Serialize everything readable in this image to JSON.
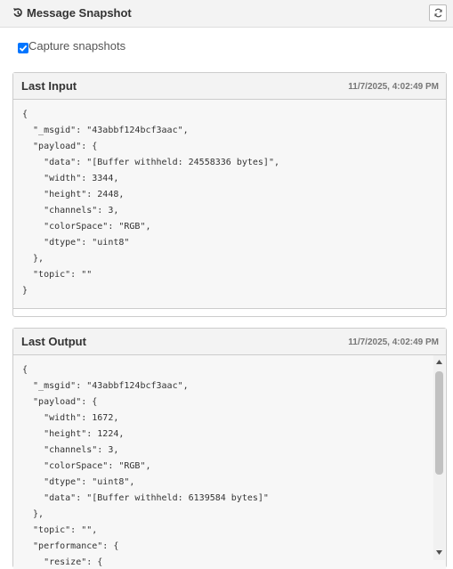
{
  "header": {
    "title": "Message Snapshot",
    "history_icon": "history-icon",
    "refresh_icon": "refresh-icon"
  },
  "capture": {
    "label": "Capture snapshots",
    "checked": true
  },
  "last_input": {
    "title": "Last Input",
    "timestamp": "11/7/2025, 4:02:49 PM",
    "lines": [
      "{",
      "  \"_msgid\": \"43abbf124bcf3aac\",",
      "  \"payload\": {",
      "    \"data\": \"[Buffer withheld: 24558336 bytes]\",",
      "    \"width\": 3344,",
      "    \"height\": 2448,",
      "    \"channels\": 3,",
      "    \"colorSpace\": \"RGB\",",
      "    \"dtype\": \"uint8\"",
      "  },",
      "  \"topic\": \"\"",
      "}"
    ]
  },
  "last_output": {
    "title": "Last Output",
    "timestamp": "11/7/2025, 4:02:49 PM",
    "lines": [
      "{",
      "  \"_msgid\": \"43abbf124bcf3aac\",",
      "  \"payload\": {",
      "    \"width\": 1672,",
      "    \"height\": 1224,",
      "    \"channels\": 3,",
      "    \"colorSpace\": \"RGB\",",
      "    \"dtype\": \"uint8\",",
      "    \"data\": \"[Buffer withheld: 6139584 bytes]\"",
      "  },",
      "  \"topic\": \"\",",
      "  \"performance\": {",
      "    \"resize\": {"
    ]
  }
}
